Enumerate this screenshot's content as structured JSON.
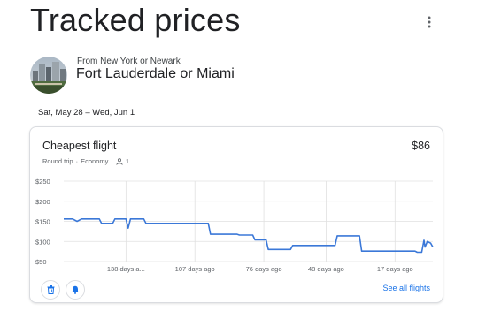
{
  "header": {
    "title": "Tracked prices"
  },
  "route": {
    "origin_text": "From New York or Newark",
    "destination_text": "Fort Lauderdale or Miami"
  },
  "trip": {
    "dates": "Sat, May 28 – Wed, Jun 1"
  },
  "card": {
    "title": "Cheapest flight",
    "price": "$86",
    "trip_type": "Round trip",
    "cabin": "Economy",
    "passengers": "1",
    "separator": "·",
    "see_all_label": "See all flights",
    "line_color": "#3b78d8"
  },
  "icons": {
    "more": "more-vert-icon",
    "delete": "trash-icon",
    "alert": "bell-icon",
    "person": "person-icon"
  },
  "chart_data": {
    "type": "line",
    "ylabels": [
      "$250",
      "$200",
      "$150",
      "$100",
      "$50"
    ],
    "yticks": [
      250,
      200,
      150,
      100,
      50
    ],
    "ylim": [
      50,
      250
    ],
    "xlim": [
      -166,
      0
    ],
    "xunit": "days ago",
    "xticks": [
      {
        "x": -138,
        "label": "138 days a..."
      },
      {
        "x": -107,
        "label": "107 days ago"
      },
      {
        "x": -76,
        "label": "76 days ago"
      },
      {
        "x": -48,
        "label": "48 days ago"
      },
      {
        "x": -17,
        "label": "17 days ago"
      }
    ],
    "grid": true,
    "series": [
      {
        "values": [
          [
            -166,
            156
          ],
          [
            -162,
            156
          ],
          [
            -160,
            150
          ],
          [
            -158,
            156
          ],
          [
            -150,
            156
          ],
          [
            -149,
            145
          ],
          [
            -144,
            145
          ],
          [
            -143,
            156
          ],
          [
            -138,
            156
          ],
          [
            -137,
            133
          ],
          [
            -136,
            156
          ],
          [
            -130,
            156
          ],
          [
            -129,
            145
          ],
          [
            -101,
            145
          ],
          [
            -100,
            118
          ],
          [
            -88,
            118
          ],
          [
            -87,
            116
          ],
          [
            -81,
            116
          ],
          [
            -80,
            104
          ],
          [
            -75,
            104
          ],
          [
            -74,
            80
          ],
          [
            -64,
            80
          ],
          [
            -63,
            90
          ],
          [
            -44,
            90
          ],
          [
            -43,
            114
          ],
          [
            -33,
            114
          ],
          [
            -32,
            76
          ],
          [
            -8,
            76
          ],
          [
            -7,
            73
          ],
          [
            -5,
            73
          ],
          [
            -4,
            103
          ],
          [
            -3.5,
            86
          ],
          [
            -2.5,
            100
          ],
          [
            -1,
            96
          ],
          [
            0,
            86
          ]
        ]
      }
    ]
  }
}
